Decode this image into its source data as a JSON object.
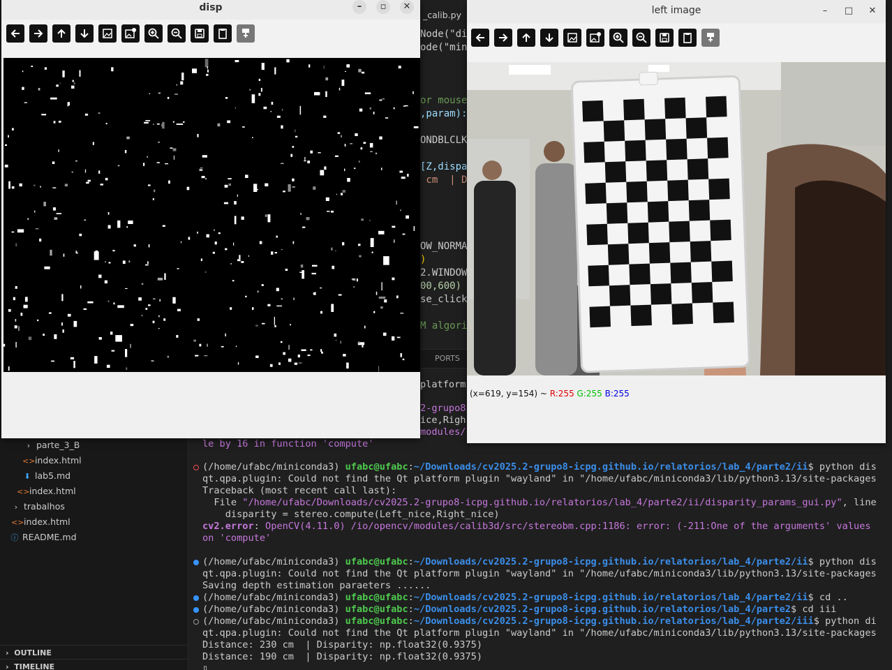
{
  "sidebar": {
    "items": [
      {
        "label": "parte_3_B",
        "kind": "folder"
      },
      {
        "label": "index.html",
        "kind": "html"
      },
      {
        "label": "lab5.md",
        "kind": "md"
      },
      {
        "label": "index.html",
        "kind": "html"
      },
      {
        "label": "trabalhos",
        "kind": "folder"
      },
      {
        "label": "index.html",
        "kind": "html"
      },
      {
        "label": "README.md",
        "kind": "info"
      }
    ],
    "outline_label": "OUTLINE",
    "timeline_label": "TIMELINE"
  },
  "editor": {
    "tab_label": "_calib.py",
    "code_lines": [
      {
        "text": "Node(\"di",
        "color": "#cccccc"
      },
      {
        "text": "ode(\"min",
        "color": "#cccccc"
      },
      {
        "text": "or mouse",
        "color": "#6a9955"
      },
      {
        "text": ",param):",
        "color": "#9cdcfe"
      },
      {
        "text": "ONDBLCLK",
        "color": "#cccccc"
      },
      {
        "text": "[Z,dispa",
        "color": "#9cdcfe"
      },
      {
        "text": " cm  | D",
        "color": "#ce9178"
      },
      {
        "text": "OW_NORMA",
        "color": "#cccccc"
      },
      {
        "text": ")",
        "color": "#ffd700"
      },
      {
        "text": "2.WINDOW",
        "color": "#cccccc"
      },
      {
        "text": "00,600)",
        "color": "#b5cea8"
      },
      {
        "text": "se_click",
        "color": "#cccccc"
      },
      {
        "text": "M algori",
        "color": "#6a9955"
      }
    ],
    "ports_label": "PORTS"
  },
  "terminal": {
    "top_lines": [
      {
        "text": "platform",
        "color": "#cccccc"
      },
      {
        "text": "2-grupo8",
        "color": "#c678dd"
      },
      {
        "text": "ice,Righ",
        "color": "#cccccc"
      },
      {
        "text": "modules/",
        "color": "#c678dd"
      },
      {
        "text": "le by 16 in function 'compute'",
        "color": "#c678dd"
      }
    ],
    "lines": [
      {
        "marker": "error",
        "segments": [
          {
            "t": "(/home/ufabc/miniconda3) ",
            "c": "#cccccc"
          },
          {
            "t": "ufabc@ufabc",
            "c": "#4ec94e",
            "b": true
          },
          {
            "t": ":",
            "c": "#cccccc"
          },
          {
            "t": "~/Downloads/cv2025.2-grupo8-icpg.github.io/relatorios/lab_4/parte2/ii",
            "c": "#3b8eea",
            "b": true
          },
          {
            "t": "$ python dis",
            "c": "#cccccc"
          }
        ]
      },
      {
        "marker": "",
        "segments": [
          {
            "t": "qt.qpa.plugin: Could not find the Qt platform plugin \"wayland\" in \"/home/ufabc/miniconda3/lib/python3.13/site-packages",
            "c": "#cccccc"
          }
        ]
      },
      {
        "marker": "",
        "segments": [
          {
            "t": "Traceback (most recent call last):",
            "c": "#cccccc"
          }
        ]
      },
      {
        "marker": "",
        "segments": [
          {
            "t": "  File ",
            "c": "#cccccc"
          },
          {
            "t": "\"/home/ufabc/Downloads/cv2025.2-grupo8-icpg.github.io/relatorios/lab_4/parte2/ii/disparity_params_gui.py\"",
            "c": "#c678dd"
          },
          {
            "t": ", line",
            "c": "#cccccc"
          }
        ]
      },
      {
        "marker": "",
        "segments": [
          {
            "t": "    disparity = stereo.compute(Left_nice,Right_nice)",
            "c": "#cccccc"
          }
        ]
      },
      {
        "marker": "",
        "segments": [
          {
            "t": "cv2.error",
            "c": "#c678dd",
            "b": true
          },
          {
            "t": ": ",
            "c": "#cccccc"
          },
          {
            "t": "OpenCV(4.11.0) /io/opencv/modules/calib3d/src/stereobm.cpp:1186: error: (-211:One of the arguments' values",
            "c": "#c678dd"
          }
        ]
      },
      {
        "marker": "",
        "segments": [
          {
            "t": "on 'compute'",
            "c": "#c678dd"
          }
        ]
      },
      {
        "marker": "",
        "segments": [
          {
            "t": "",
            "c": "#cccccc"
          }
        ]
      },
      {
        "marker": "ok",
        "segments": [
          {
            "t": "(/home/ufabc/miniconda3) ",
            "c": "#cccccc"
          },
          {
            "t": "ufabc@ufabc",
            "c": "#4ec94e",
            "b": true
          },
          {
            "t": ":",
            "c": "#cccccc"
          },
          {
            "t": "~/Downloads/cv2025.2-grupo8-icpg.github.io/relatorios/lab_4/parte2/ii",
            "c": "#3b8eea",
            "b": true
          },
          {
            "t": "$ python dis",
            "c": "#cccccc"
          }
        ]
      },
      {
        "marker": "",
        "segments": [
          {
            "t": "qt.qpa.plugin: Could not find the Qt platform plugin \"wayland\" in \"/home/ufabc/miniconda3/lib/python3.13/site-packages",
            "c": "#cccccc"
          }
        ]
      },
      {
        "marker": "",
        "segments": [
          {
            "t": "Saving depth estimation paraeters ......",
            "c": "#cccccc"
          }
        ]
      },
      {
        "marker": "ok",
        "segments": [
          {
            "t": "(/home/ufabc/miniconda3) ",
            "c": "#cccccc"
          },
          {
            "t": "ufabc@ufabc",
            "c": "#4ec94e",
            "b": true
          },
          {
            "t": ":",
            "c": "#cccccc"
          },
          {
            "t": "~/Downloads/cv2025.2-grupo8-icpg.github.io/relatorios/lab_4/parte2/ii",
            "c": "#3b8eea",
            "b": true
          },
          {
            "t": "$ cd ..",
            "c": "#cccccc"
          }
        ]
      },
      {
        "marker": "ok",
        "segments": [
          {
            "t": "(/home/ufabc/miniconda3) ",
            "c": "#cccccc"
          },
          {
            "t": "ufabc@ufabc",
            "c": "#4ec94e",
            "b": true
          },
          {
            "t": ":",
            "c": "#cccccc"
          },
          {
            "t": "~/Downloads/cv2025.2-grupo8-icpg.github.io/relatorios/lab_4/parte2",
            "c": "#3b8eea",
            "b": true
          },
          {
            "t": "$ cd iii",
            "c": "#cccccc"
          }
        ]
      },
      {
        "marker": "pending",
        "segments": [
          {
            "t": "(/home/ufabc/miniconda3) ",
            "c": "#cccccc"
          },
          {
            "t": "ufabc@ufabc",
            "c": "#4ec94e",
            "b": true
          },
          {
            "t": ":",
            "c": "#cccccc"
          },
          {
            "t": "~/Downloads/cv2025.2-grupo8-icpg.github.io/relatorios/lab_4/parte2/iii",
            "c": "#3b8eea",
            "b": true
          },
          {
            "t": "$ python di",
            "c": "#cccccc"
          }
        ]
      },
      {
        "marker": "",
        "segments": [
          {
            "t": "qt.qpa.plugin: Could not find the Qt platform plugin \"wayland\" in \"/home/ufabc/miniconda3/lib/python3.13/site-packages",
            "c": "#cccccc"
          }
        ]
      },
      {
        "marker": "",
        "segments": [
          {
            "t": "Distance: 230 cm  | Disparity: np.float32(0.9375)",
            "c": "#cccccc"
          }
        ]
      },
      {
        "marker": "",
        "segments": [
          {
            "t": "Distance: 190 cm  | Disparity: np.float32(0.9375)",
            "c": "#cccccc"
          }
        ]
      },
      {
        "marker": "",
        "segments": [
          {
            "t": "▯",
            "c": "#cccccc"
          }
        ]
      }
    ]
  },
  "disp_window": {
    "title": "disp",
    "minimize_glyph": "–",
    "maximize_glyph": "▫",
    "close_glyph": "✕"
  },
  "left_window": {
    "title": "left image",
    "minimize_glyph": "–",
    "maximize_glyph": "□",
    "close_glyph": "✕",
    "status": {
      "coords": "(x=619, y=154) ~ ",
      "r": "R:255",
      "g": "G:255",
      "b": "B:255"
    }
  },
  "toolbar_icons": [
    "arrow-left-icon",
    "arrow-right-icon",
    "arrow-up-icon",
    "arrow-down-icon",
    "image-icon",
    "image-settings-icon",
    "zoom-in-icon",
    "zoom-out-icon",
    "save-icon",
    "clipboard-icon",
    "properties-icon"
  ],
  "colors": {
    "status_r": "#e00000",
    "status_g": "#00c000",
    "status_b": "#0000e0"
  }
}
